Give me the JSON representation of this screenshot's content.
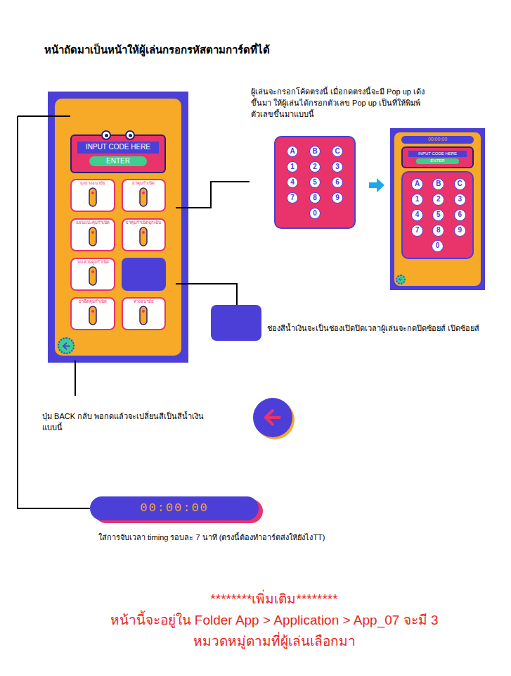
{
  "heading": "หน้าถัดมาเป็นหน้าให้ผู้เล่นกรอกรหัสตามการ์ดที่ได้",
  "main_screen": {
    "code_placeholder": "INPUT CODE HERE",
    "enter": "ENTER",
    "cards": [
      {
        "label": "ถุงยางอนามัย",
        "kind": "card"
      },
      {
        "label": "ยาคุมกำเนิด",
        "kind": "card"
      },
      {
        "label": "แผ่นแปะคุมกำเนิด",
        "kind": "card"
      },
      {
        "label": "ยาคุมกำเนิดฉุกเฉิน",
        "kind": "card"
      },
      {
        "label": "วงแหวนคุมกำเนิด",
        "kind": "card"
      },
      {
        "label": "",
        "kind": "sound-toggle"
      },
      {
        "label": "ยาฉีดคุมกำเนิด",
        "kind": "card"
      },
      {
        "label": "ห่วงอนามัย",
        "kind": "card"
      }
    ],
    "back_button": {
      "pressed": false
    }
  },
  "keypad_note": {
    "lines": [
      "ผู้เล่นจะกรอกโค้ดตรงนี้ เมื่อกดตรงนี้จะมี Pop up เด้ง",
      "ขึ้นมา ให้ผู้เล่นได้กรอกตัวเลข Pop up เป็นที่ให้พิมพ์",
      "ตัวเลขขึ้นมาแบบนี้"
    ]
  },
  "keypad": {
    "keys": [
      "A",
      "B",
      "C",
      "1",
      "2",
      "3",
      "4",
      "5",
      "6",
      "7",
      "8",
      "9",
      "0"
    ]
  },
  "popup_screen": {
    "timer": "00:00:00",
    "code_placeholder": "INPUT CODE HERE",
    "enter": "ENTER",
    "keys": [
      "A",
      "B",
      "C",
      "1",
      "2",
      "3",
      "4",
      "5",
      "6",
      "7",
      "8",
      "9",
      "0"
    ],
    "back_button": {
      "pressed": false
    }
  },
  "toggle_note": "ช่องสีน้ำเงินจะเป็นช่องเปิดปิดเวลาผู้เล่นจะกดปิดซ้อยส์ เปิดซ้อยส์",
  "back_note": {
    "lines": [
      "ปุ่ม BACK กลับ พอกดแล้วจะเปลี่ยนสีเป็นสีน้ำเงิน",
      "แบบนี้"
    ],
    "pressed": true
  },
  "timer": {
    "value": "00:00:00",
    "note": "ใส่การจับเวลา timing รอบละ 7 นาที (ตรงนี้ต้องทำอาร์ตส่งให้ยังไงTT)"
  },
  "extra": {
    "title": "********เพิ่มเติม********",
    "lines": [
      "หน้านี้จะอยู่ใน Folder App > Application > App_07 จะมี 3",
      "หมวดหมู่ตามที่ผู้เล่นเลือกมา"
    ]
  }
}
